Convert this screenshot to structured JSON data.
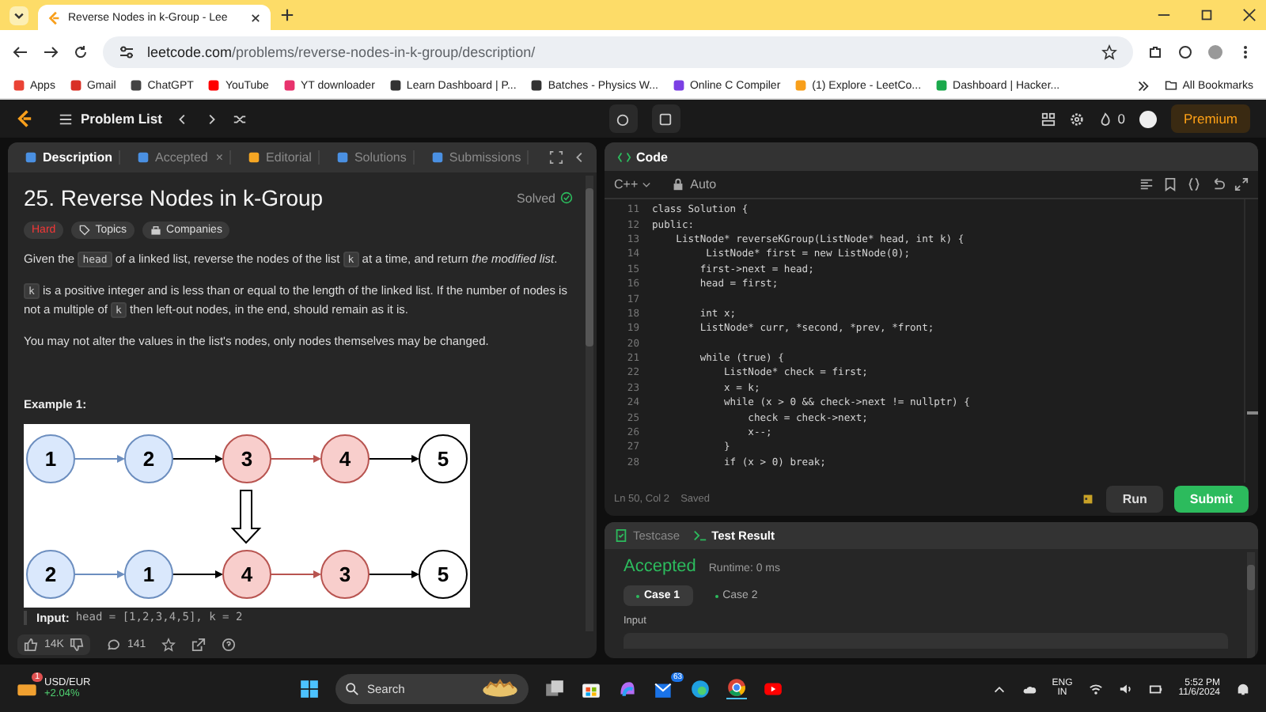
{
  "browser": {
    "tab_title": "Reverse Nodes in k-Group - Lee",
    "url_host": "leetcode.com",
    "url_path": "/problems/reverse-nodes-in-k-group/description/",
    "bookmarks": [
      {
        "label": "Apps",
        "color": "#ea4335"
      },
      {
        "label": "Gmail",
        "color": "#d93025"
      },
      {
        "label": "ChatGPT",
        "color": "#444444"
      },
      {
        "label": "YouTube",
        "color": "#ff0000"
      },
      {
        "label": "YT downloader",
        "color": "#e8336d"
      },
      {
        "label": "Learn Dashboard | P...",
        "color": "#333333"
      },
      {
        "label": "Batches - Physics W...",
        "color": "#333333"
      },
      {
        "label": "Online C Compiler",
        "color": "#7b3fe4"
      },
      {
        "label": "(1) Explore - LeetCo...",
        "color": "#f89f1b"
      },
      {
        "label": "Dashboard | Hacker...",
        "color": "#1ba94c"
      }
    ],
    "all_bookmarks": "All Bookmarks"
  },
  "nav": {
    "problem_list": "Problem List",
    "streak": "0",
    "premium": "Premium"
  },
  "description": {
    "tabs": [
      {
        "label": "Description",
        "selected": true,
        "color": "#4a90e2"
      },
      {
        "label": "Accepted",
        "selected": false,
        "close": "×",
        "color": "#4a90e2"
      },
      {
        "label": "Editorial",
        "selected": false,
        "color": "#f5a623"
      },
      {
        "label": "Solutions",
        "selected": false,
        "color": "#4a90e2"
      },
      {
        "label": "Submissions",
        "selected": false,
        "color": "#4a90e2"
      }
    ],
    "title": "25. Reverse Nodes in k-Group",
    "status": "Solved",
    "tags": [
      {
        "label": "Hard",
        "kind": "difficulty"
      },
      {
        "label": "Topics",
        "kind": "topics"
      },
      {
        "label": "Companies",
        "kind": "companies"
      }
    ],
    "paragraphs": [
      [
        {
          "kind": "text",
          "text": "Given the "
        },
        {
          "kind": "code",
          "text": "head"
        },
        {
          "kind": "text",
          "text": " of a linked list, reverse the nodes of the list "
        },
        {
          "kind": "code",
          "text": "k"
        },
        {
          "kind": "text",
          "text": " at a time, and return *the modified list*."
        }
      ],
      [
        {
          "kind": "code",
          "text": "k"
        },
        {
          "kind": "text",
          "text": " is a positive integer and is less than or equal to the length of the linked list. If the number of nodes is not a multiple of "
        },
        {
          "kind": "code",
          "text": "k"
        },
        {
          "kind": "text",
          "text": " then left-out nodes, in the end, should remain as it is."
        }
      ],
      [
        {
          "kind": "text",
          "text": "You may not alter the values in the list's nodes, only nodes themselves may be changed."
        }
      ]
    ],
    "example_title": "Example 1:",
    "diagram": {
      "rows": [
        [
          {
            "label": "1",
            "color": "#dae8fc"
          },
          {
            "label": "2",
            "color": "#dae8fc"
          },
          {
            "label": "3",
            "color": "#f8cecc"
          },
          {
            "label": "4",
            "color": "#f8cecc"
          },
          {
            "label": "5",
            "color": "#ffffff"
          }
        ],
        [
          {
            "label": "2",
            "color": "#dae8fc"
          },
          {
            "label": "1",
            "color": "#dae8fc"
          },
          {
            "label": "4",
            "color": "#f8cecc"
          },
          {
            "label": "3",
            "color": "#f8cecc"
          },
          {
            "label": "5",
            "color": "#ffffff"
          }
        ]
      ]
    },
    "input_label": "Input:",
    "input_value": "head = [1,2,3,4,5], k = 2",
    "likes": "14K",
    "comments": "141"
  },
  "code": {
    "title": "Code",
    "language": "C++",
    "mode": "Auto",
    "lines": [
      {
        "n": "11",
        "text": "class Solution {"
      },
      {
        "n": "12",
        "text": "public:"
      },
      {
        "n": "13",
        "text": "    ListNode* reverseKGroup(ListNode* head, int k) {"
      },
      {
        "n": "14",
        "text": "         ListNode* first = new ListNode(0);"
      },
      {
        "n": "15",
        "text": "        first->next = head;"
      },
      {
        "n": "16",
        "text": "        head = first;"
      },
      {
        "n": "17"
      },
      {
        "n": "18",
        "text": "        int x;"
      },
      {
        "n": "19",
        "text": "        ListNode* curr, *second, *prev, *front;"
      },
      {
        "n": "20"
      },
      {
        "n": "21",
        "text": "        while (true) {"
      },
      {
        "n": "22",
        "text": "            ListNode* check = first;"
      },
      {
        "n": "23",
        "text": "            x = k;"
      },
      {
        "n": "24",
        "text": "            while (x > 0 && check->next != nullptr) {"
      },
      {
        "n": "25",
        "text": "                check = check->next;"
      },
      {
        "n": "26",
        "text": "                x--;"
      },
      {
        "n": "27",
        "text": "            }"
      },
      {
        "n": "28",
        "text": "            if (x > 0) break;"
      }
    ],
    "position": "Ln 50, Col 2",
    "saved": "Saved",
    "run": "Run",
    "submit": "Submit"
  },
  "result": {
    "tabs": [
      {
        "label": "Testcase",
        "selected": false
      },
      {
        "label": "Test Result",
        "selected": true
      }
    ],
    "verdict": "Accepted",
    "runtime": "Runtime: 0 ms",
    "cases": [
      {
        "label": "Case 1",
        "selected": true
      },
      {
        "label": "Case 2",
        "selected": false
      }
    ],
    "input_label": "Input"
  },
  "taskbar": {
    "widget_title": "USD/EUR",
    "widget_change": "+2.04%",
    "widget_badge": "1",
    "search": "Search",
    "app_badge": "63",
    "lang": "ENG",
    "region": "IN",
    "time": "5:52 PM",
    "date": "11/6/2024"
  }
}
